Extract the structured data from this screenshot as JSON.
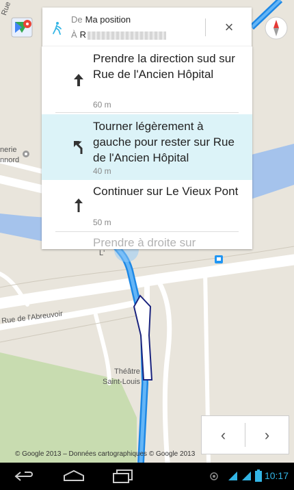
{
  "map": {
    "labels": {
      "street_crignon": "Rue Crignon",
      "street_abreuvoir": "Rue de l'Abreuvoir",
      "place_nerie": "nerie",
      "place_nnord": "nnord",
      "river_label": "L'",
      "theatre": "Théâtre",
      "theatre2": "Saint-Louis"
    },
    "route_color": "#2196f3",
    "water_color": "#a5c3ec",
    "park_color": "#c8dcb0",
    "road_color": "#ffffff"
  },
  "icons": {
    "maps_logo": "google-maps-logo",
    "compass": "compass-icon",
    "walk": "walking-person-icon"
  },
  "directions_card": {
    "from_prefix": "De",
    "from_value": "Ma position",
    "to_prefix": "À",
    "to_value": "R",
    "close_label": "×"
  },
  "steps": [
    {
      "icon": "straight-arrow-icon",
      "text": "Prendre la direction sud sur Rue de l'Ancien Hôpital",
      "distance": "60 m",
      "highlighted": false
    },
    {
      "icon": "slight-left-arrow-icon",
      "text": "Tourner légèrement à gauche pour rester sur Rue de l'Ancien Hôpital",
      "distance": "40 m",
      "highlighted": true
    },
    {
      "icon": "straight-arrow-icon",
      "text": "Continuer sur Le Vieux Pont",
      "distance": "50 m",
      "highlighted": false
    },
    {
      "icon": "right-turn-arrow-icon",
      "text": "Prendre à droite sur",
      "distance": "",
      "highlighted": false
    }
  ],
  "nav": {
    "prev": "‹",
    "next": "›"
  },
  "copyright": "© Google 2013 – Données cartographiques © Google 2013",
  "system_bar": {
    "time": "10:17",
    "accent_color": "#33b5e5",
    "nav_icons": [
      "back-icon",
      "home-icon",
      "recent-apps-icon"
    ],
    "status_icons": [
      "gps-icon",
      "signal-icon",
      "wifi-icon",
      "battery-icon"
    ]
  }
}
